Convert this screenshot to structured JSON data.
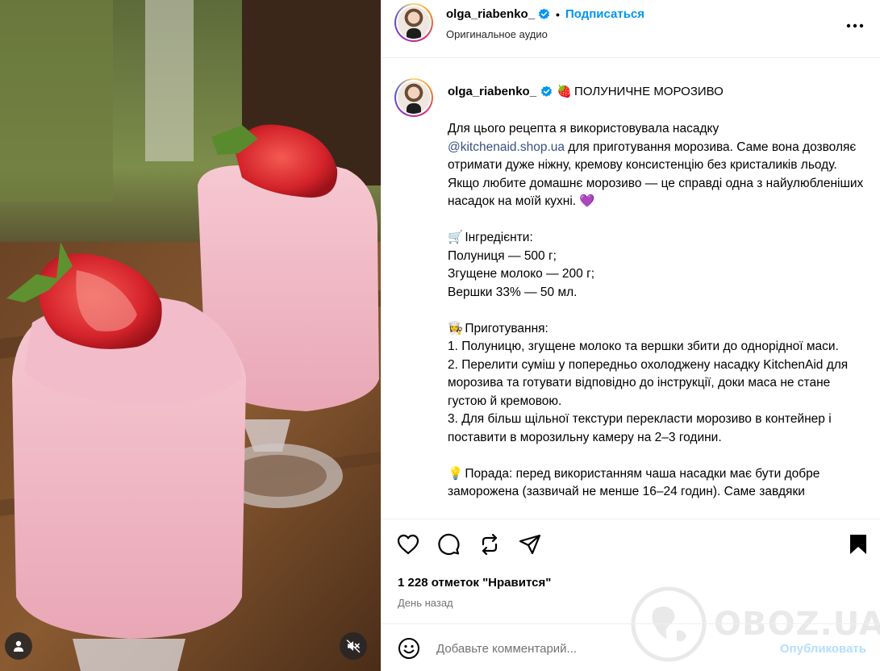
{
  "header": {
    "username": "olga_riabenko_",
    "separator": "•",
    "follow_label": "Подписаться",
    "audio_label": "Оригинальное аудио"
  },
  "caption": {
    "username": "olga_riabenko_",
    "title_emoji": "🍓",
    "title": "ПОЛУНИЧНЕ МОРОЗИВО",
    "intro_before": "Для цього рецепта я використовувала насадку",
    "mention": "@kitchenaid.shop.ua",
    "intro_after": " для приготування морозива. Саме вона дозволяє отримати дуже ніжну, кремову консистенцію без кристаликів льоду. Якщо любите домашнє морозиво — це справді одна з найулюбленіших насадок на моїй кухні. ",
    "intro_emoji": "💜",
    "ingredients_emoji": "🛒",
    "ingredients_title": "Інгредієнти:",
    "ingredients": [
      "Полуниця — 500 г;",
      "Згущене молоко — 200 г;",
      "Вершки 33% — 50 мл."
    ],
    "prep_emoji": "👩‍🍳",
    "prep_title": "Приготування:",
    "steps": [
      "1. Полуницю, згущене молоко та вершки збити до однорідної маси.",
      "2. Перелити суміш у попередньо охолоджену насадку KitchenAid для морозива та готувати відповідно до інструкції, доки маса не стане густою й кремовою.",
      "3. Для більш щільної текстури перекласти морозиво в контейнер і поставити в морозильну камеру на 2–3 години."
    ],
    "tip_emoji": "💡",
    "tip": "Порада: перед використанням чаша насадки має бути добре заморожена (зазвичай не менше 16–24 годин). Саме завдяки"
  },
  "actions": {
    "icons": [
      "heart-icon",
      "comment-icon",
      "repost-icon",
      "share-icon",
      "bookmark-icon"
    ],
    "likes": "1 228 отметок \"Нравится\"",
    "posted": "День назад"
  },
  "watermark": {
    "text": "OBOZ.UA"
  },
  "comment": {
    "placeholder": "Добавьте комментарий...",
    "publish_label": "Опубликовать"
  },
  "colors": {
    "accent": "#0095f6",
    "publish_disabled": "#b2dffc",
    "mention": "#385185",
    "verified": "#0095f6",
    "border": "#efefef",
    "secondary_text": "#737373"
  }
}
